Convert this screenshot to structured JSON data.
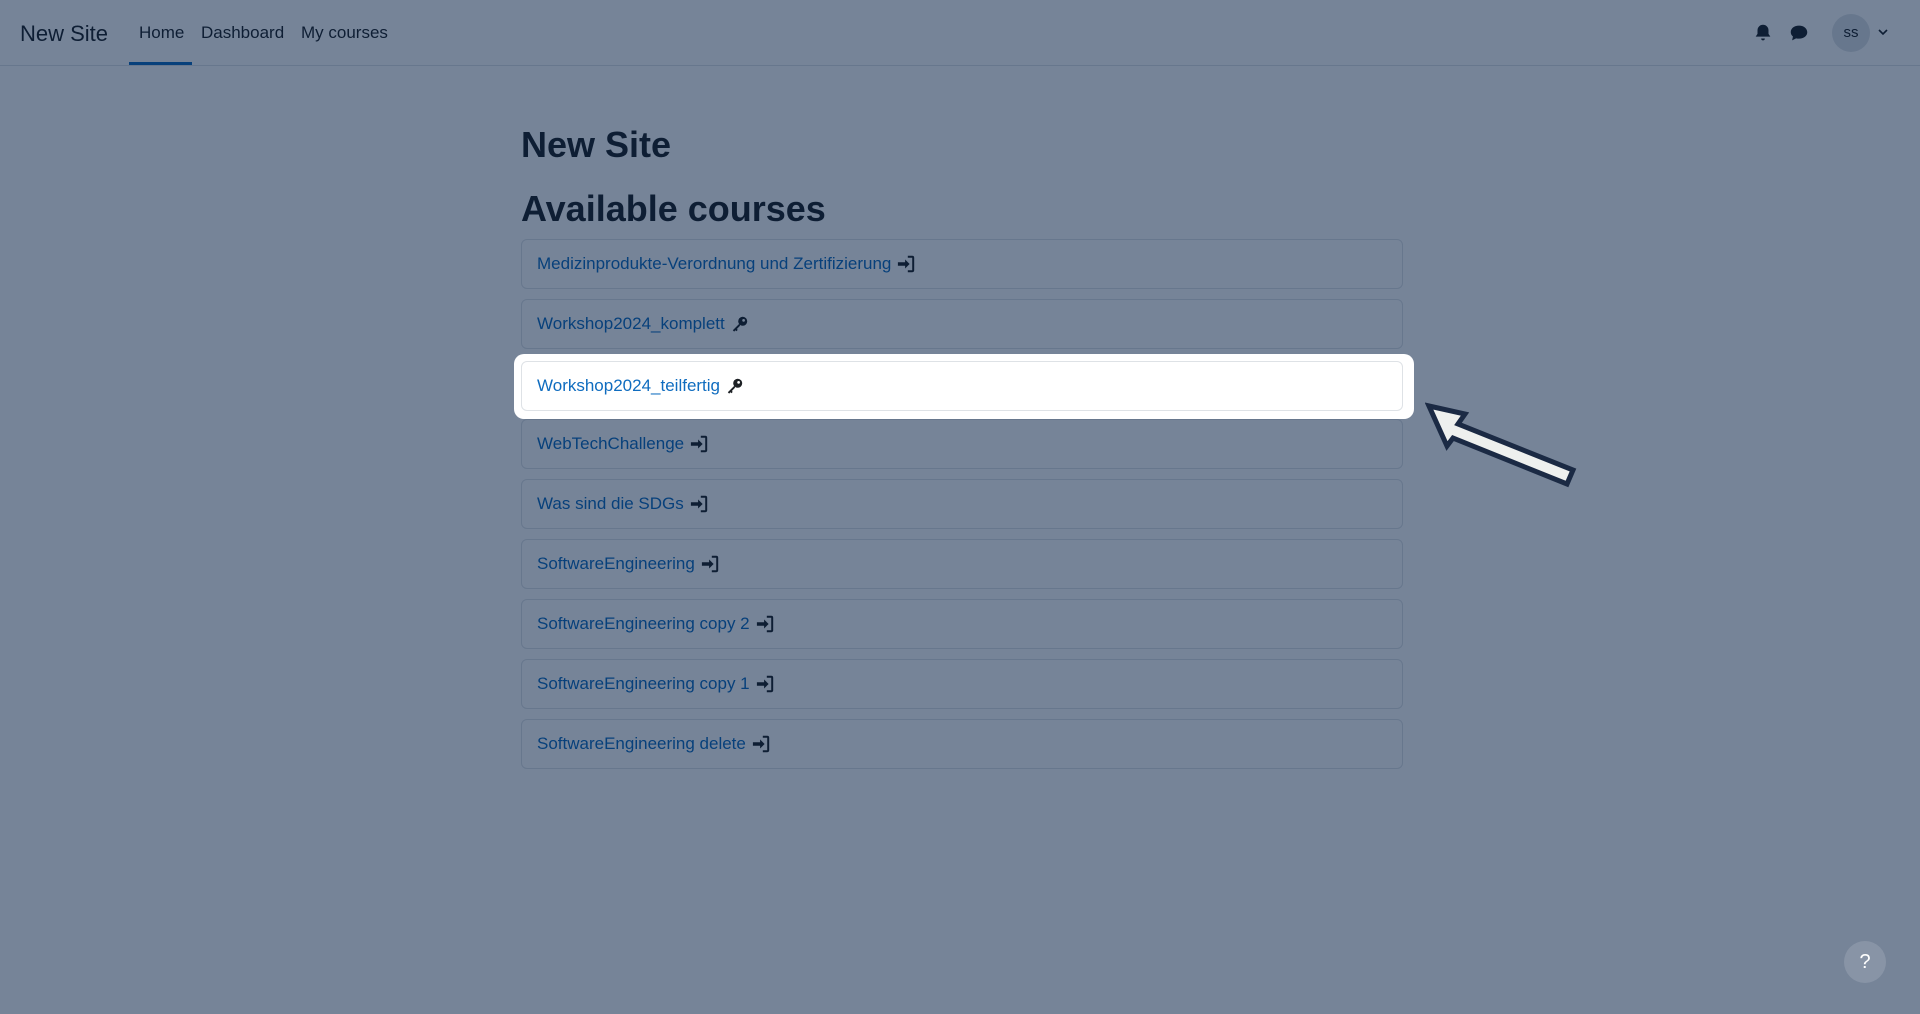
{
  "navbar": {
    "brand": "New Site",
    "links": [
      {
        "label": "Home"
      },
      {
        "label": "Dashboard"
      },
      {
        "label": "My courses"
      }
    ],
    "user_initials": "ss"
  },
  "main": {
    "site_title": "New Site",
    "section_title": "Available courses",
    "courses": [
      {
        "name": "Medizinprodukte-Verordnung und Zertifizierung",
        "icon": "sign-in-icon"
      },
      {
        "name": "Workshop2024_komplett",
        "icon": "key-icon"
      },
      {
        "name": "Workshop2024_teilfertig",
        "icon": "key-icon"
      },
      {
        "name": "WebTechChallenge",
        "icon": "sign-in-icon"
      },
      {
        "name": "Was sind die SDGs",
        "icon": "sign-in-icon"
      },
      {
        "name": "SoftwareEngineering",
        "icon": "sign-in-icon"
      },
      {
        "name": "SoftwareEngineering copy 2",
        "icon": "sign-in-icon"
      },
      {
        "name": "SoftwareEngineering copy 1",
        "icon": "sign-in-icon"
      },
      {
        "name": "SoftwareEngineering delete",
        "icon": "sign-in-icon"
      }
    ]
  },
  "help_button": "?",
  "colors": {
    "link": "#0f6cbf",
    "overlay": "#011b40",
    "text": "#1d2125"
  }
}
